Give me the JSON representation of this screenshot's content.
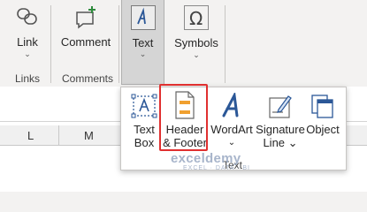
{
  "ribbon": {
    "link_label": "Link",
    "comment_label": "Comment",
    "text_label": "Text",
    "symbols_label": "Symbols",
    "links_group": "Links",
    "comments_group": "Comments",
    "chevron": "⌄"
  },
  "sheet": {
    "columns": [
      "L",
      "M"
    ]
  },
  "dropdown": {
    "items": [
      {
        "line1": "Text",
        "line2": "Box"
      },
      {
        "line1": "Header",
        "line2": "& Footer"
      },
      {
        "line1": "WordArt",
        "line2": "⌄"
      },
      {
        "line1": "Signature",
        "line2": "Line ⌄"
      },
      {
        "line1": "Object",
        "line2": ""
      }
    ],
    "group_label": "Text"
  },
  "watermark": {
    "main": "exceldemy",
    "sub": "EXCEL · DATA · BI"
  },
  "colors": {
    "accent": "#2b5797",
    "highlight": "#e03030"
  }
}
